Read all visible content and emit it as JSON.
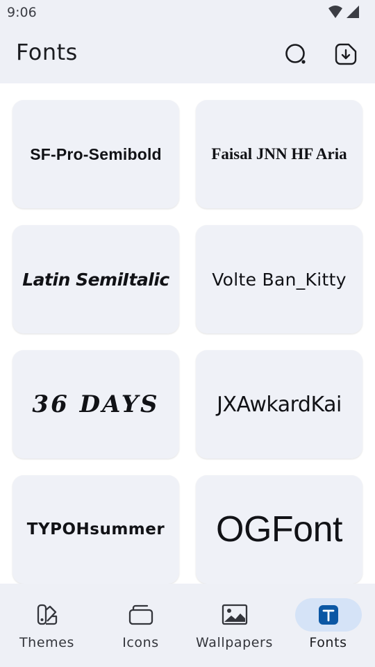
{
  "status_bar": {
    "time": "9:06",
    "icons": [
      "wifi-icon",
      "signal-icon"
    ]
  },
  "app_bar": {
    "title": "Fonts",
    "actions": [
      {
        "name": "search",
        "icon": "search-icon"
      },
      {
        "name": "downloads",
        "icon": "download-icon"
      }
    ]
  },
  "fonts": {
    "items": [
      {
        "label": "SF-Pro-Semibold"
      },
      {
        "label": "Faisal JNN HF Aria"
      },
      {
        "label": "Latin SemiItalic"
      },
      {
        "label": "Volte Ban_Kitty"
      },
      {
        "label": "36 DAYS"
      },
      {
        "label": "JXAwkardKai"
      },
      {
        "label": "TYPOHsummer"
      },
      {
        "label": "OGFont"
      }
    ]
  },
  "bottom_nav": {
    "items": [
      {
        "label": "Themes",
        "icon": "themes-icon"
      },
      {
        "label": "Icons",
        "icon": "icons-icon"
      },
      {
        "label": "Wallpapers",
        "icon": "wallpaper-icon"
      },
      {
        "label": "Fonts",
        "icon": "fonts-icon",
        "active": true
      }
    ]
  },
  "colors": {
    "surface": "#eef0f6",
    "card": "#eff1f7",
    "active_indicator": "#d5e3f7",
    "accent": "#0b57a4"
  }
}
